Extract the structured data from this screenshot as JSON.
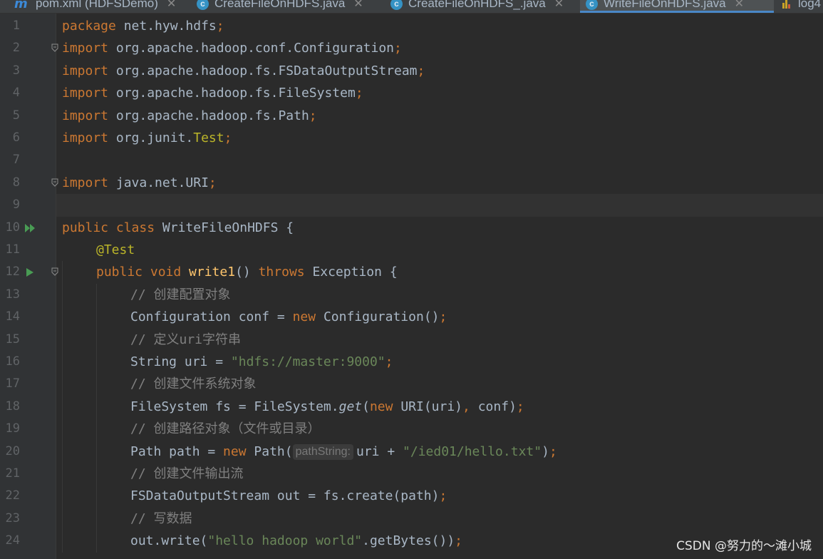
{
  "tabs": [
    {
      "label": "pom.xml (HDFSDemo)",
      "icon": "maven-icon",
      "active": false
    },
    {
      "label": "CreateFileOnHDFS.java",
      "icon": "java-class-icon",
      "active": false
    },
    {
      "label": "CreateFileOnHDFS_.java",
      "icon": "java-class-icon",
      "active": false
    },
    {
      "label": "WriteFileOnHDFS.java",
      "icon": "java-class-icon",
      "active": true
    },
    {
      "label": "log4",
      "icon": "properties-file-icon",
      "active": false
    }
  ],
  "colors": {
    "background": "#2b2b2b",
    "keyword": "#cc7832",
    "string": "#6a8759",
    "annotation": "#bbb529",
    "method_decl": "#ffc66d",
    "comment": "#808080",
    "plain": "#a9b7c6",
    "run_icon": "#499c54"
  },
  "editor": {
    "caret_line": 9,
    "lines": [
      {
        "num": "1",
        "fold": false,
        "run": "",
        "indent": 0,
        "tokens": [
          {
            "t": "package",
            "c": "kw"
          },
          {
            "t": " net.hyw.hdfs"
          },
          {
            "t": ";",
            "c": "kw"
          }
        ]
      },
      {
        "num": "2",
        "fold": true,
        "run": "",
        "indent": 0,
        "tokens": [
          {
            "t": "import",
            "c": "kw"
          },
          {
            "t": " org.apache.hadoop.conf.Configuration"
          },
          {
            "t": ";",
            "c": "kw"
          }
        ]
      },
      {
        "num": "3",
        "fold": false,
        "run": "",
        "indent": 0,
        "tokens": [
          {
            "t": "import",
            "c": "kw"
          },
          {
            "t": " org.apache.hadoop.fs.FSDataOutputStream"
          },
          {
            "t": ";",
            "c": "kw"
          }
        ]
      },
      {
        "num": "4",
        "fold": false,
        "run": "",
        "indent": 0,
        "tokens": [
          {
            "t": "import",
            "c": "kw"
          },
          {
            "t": " org.apache.hadoop.fs.FileSystem"
          },
          {
            "t": ";",
            "c": "kw"
          }
        ]
      },
      {
        "num": "5",
        "fold": false,
        "run": "",
        "indent": 0,
        "tokens": [
          {
            "t": "import",
            "c": "kw"
          },
          {
            "t": " org.apache.hadoop.fs.Path"
          },
          {
            "t": ";",
            "c": "kw"
          }
        ]
      },
      {
        "num": "6",
        "fold": false,
        "run": "",
        "indent": 0,
        "tokens": [
          {
            "t": "import",
            "c": "kw"
          },
          {
            "t": " org.junit."
          },
          {
            "t": "Test",
            "c": "ann"
          },
          {
            "t": ";",
            "c": "kw"
          }
        ]
      },
      {
        "num": "7",
        "fold": false,
        "run": "",
        "indent": 0,
        "tokens": []
      },
      {
        "num": "8",
        "fold": true,
        "run": "",
        "indent": 0,
        "tokens": [
          {
            "t": "import",
            "c": "kw"
          },
          {
            "t": " java.net.URI"
          },
          {
            "t": ";",
            "c": "kw"
          }
        ]
      },
      {
        "num": "9",
        "fold": false,
        "run": "",
        "indent": 0,
        "tokens": []
      },
      {
        "num": "10",
        "fold": false,
        "run": "double",
        "indent": 0,
        "tokens": [
          {
            "t": "public class ",
            "c": "kw"
          },
          {
            "t": "WriteFileOnHDFS {"
          }
        ]
      },
      {
        "num": "11",
        "fold": false,
        "run": "",
        "indent": 1,
        "tokens": [
          {
            "t": "@Test",
            "c": "ann"
          }
        ]
      },
      {
        "num": "12",
        "fold": true,
        "run": "single",
        "indent": 1,
        "tokens": [
          {
            "t": "public void ",
            "c": "kw"
          },
          {
            "t": "write1",
            "c": "fn"
          },
          {
            "t": "() "
          },
          {
            "t": "throws ",
            "c": "kw"
          },
          {
            "t": "Exception {"
          }
        ]
      },
      {
        "num": "13",
        "fold": false,
        "run": "",
        "indent": 2,
        "tokens": [
          {
            "t": "// 创建配置对象",
            "c": "cmt"
          }
        ]
      },
      {
        "num": "14",
        "fold": false,
        "run": "",
        "indent": 2,
        "tokens": [
          {
            "t": "Configuration conf = "
          },
          {
            "t": "new ",
            "c": "kw"
          },
          {
            "t": "Configuration()"
          },
          {
            "t": ";",
            "c": "kw"
          }
        ]
      },
      {
        "num": "15",
        "fold": false,
        "run": "",
        "indent": 2,
        "tokens": [
          {
            "t": "// 定义uri字符串",
            "c": "cmt"
          }
        ]
      },
      {
        "num": "16",
        "fold": false,
        "run": "",
        "indent": 2,
        "tokens": [
          {
            "t": "String uri = "
          },
          {
            "t": "\"hdfs://master:9000\"",
            "c": "str"
          },
          {
            "t": ";",
            "c": "kw"
          }
        ]
      },
      {
        "num": "17",
        "fold": false,
        "run": "",
        "indent": 2,
        "tokens": [
          {
            "t": "// 创建文件系统对象",
            "c": "cmt"
          }
        ]
      },
      {
        "num": "18",
        "fold": false,
        "run": "",
        "indent": 2,
        "tokens": [
          {
            "t": "FileSystem fs = FileSystem."
          },
          {
            "t": "get",
            "c": "it"
          },
          {
            "t": "("
          },
          {
            "t": "new ",
            "c": "kw"
          },
          {
            "t": "URI(uri)"
          },
          {
            "t": ", ",
            "c": "kw"
          },
          {
            "t": "conf)"
          },
          {
            "t": ";",
            "c": "kw"
          }
        ]
      },
      {
        "num": "19",
        "fold": false,
        "run": "",
        "indent": 2,
        "tokens": [
          {
            "t": "// 创建路径对象（文件或目录）",
            "c": "cmt"
          }
        ]
      },
      {
        "num": "20",
        "fold": false,
        "run": "",
        "indent": 2,
        "tokens": [
          {
            "t": "Path path = "
          },
          {
            "t": "new ",
            "c": "kw"
          },
          {
            "t": "Path("
          },
          {
            "t": "pathString:",
            "c": "hint"
          },
          {
            "t": "uri + "
          },
          {
            "t": "\"/ied01/hello.txt\"",
            "c": "str"
          },
          {
            "t": ")"
          },
          {
            "t": ";",
            "c": "kw"
          }
        ]
      },
      {
        "num": "21",
        "fold": false,
        "run": "",
        "indent": 2,
        "tokens": [
          {
            "t": "// 创建文件输出流",
            "c": "cmt"
          }
        ]
      },
      {
        "num": "22",
        "fold": false,
        "run": "",
        "indent": 2,
        "tokens": [
          {
            "t": "FSDataOutputStream out = fs.create(path)"
          },
          {
            "t": ";",
            "c": "kw"
          }
        ]
      },
      {
        "num": "23",
        "fold": false,
        "run": "",
        "indent": 2,
        "tokens": [
          {
            "t": "// 写数据",
            "c": "cmt"
          }
        ]
      },
      {
        "num": "24",
        "fold": false,
        "run": "",
        "indent": 2,
        "tokens": [
          {
            "t": "out.write("
          },
          {
            "t": "\"hello hadoop world\"",
            "c": "str"
          },
          {
            "t": ".getBytes())"
          },
          {
            "t": ";",
            "c": "kw"
          }
        ]
      }
    ]
  },
  "watermark": "CSDN @努力的～滩小城"
}
